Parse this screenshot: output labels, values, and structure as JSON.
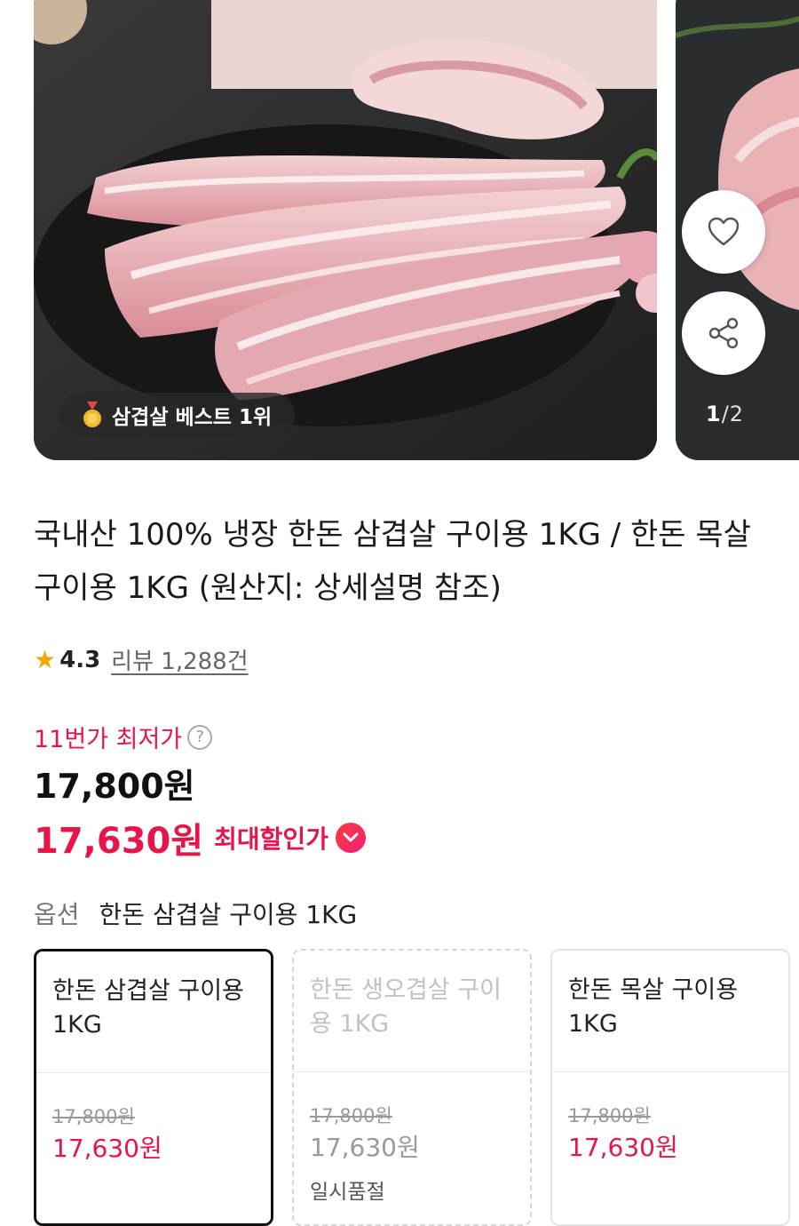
{
  "gallery": {
    "badge_text": "삼겹살 베스트 1위",
    "page_current": "1",
    "page_total": "/2"
  },
  "product": {
    "title": "국내산 100% 냉장 한돈 삼겹살 구이용 1KG / 한돈 목살 구이용 1KG (원산지: 상세설명 참조)",
    "rating": "4.3",
    "review_text": "리뷰 1,288건"
  },
  "price": {
    "lowest_label": "11번가 최저가",
    "help_icon_glyph": "?",
    "original": "17,800원",
    "sale": "17,630원",
    "sale_label": "최대할인가"
  },
  "option": {
    "label": "옵션",
    "selected": "한돈 삼겹살 구이용 1KG",
    "cards": [
      {
        "name": "한돈 삼겹살 구이용 1KG",
        "old_price": "17,800원",
        "price": "17,630원",
        "status": ""
      },
      {
        "name": "한돈 생오겹살 구이용 1KG",
        "old_price": "17,800원",
        "price": "17,630원",
        "status": "일시품절"
      },
      {
        "name": "한돈 목살 구이용 1KG",
        "old_price": "17,800원",
        "price": "17,630원",
        "status": ""
      }
    ]
  },
  "colors": {
    "accent": "#e8154b",
    "star": "#f5a800"
  },
  "icons": [
    "medal-icon",
    "heart-icon",
    "share-icon",
    "star-icon",
    "help-icon",
    "chevron-down-icon"
  ]
}
